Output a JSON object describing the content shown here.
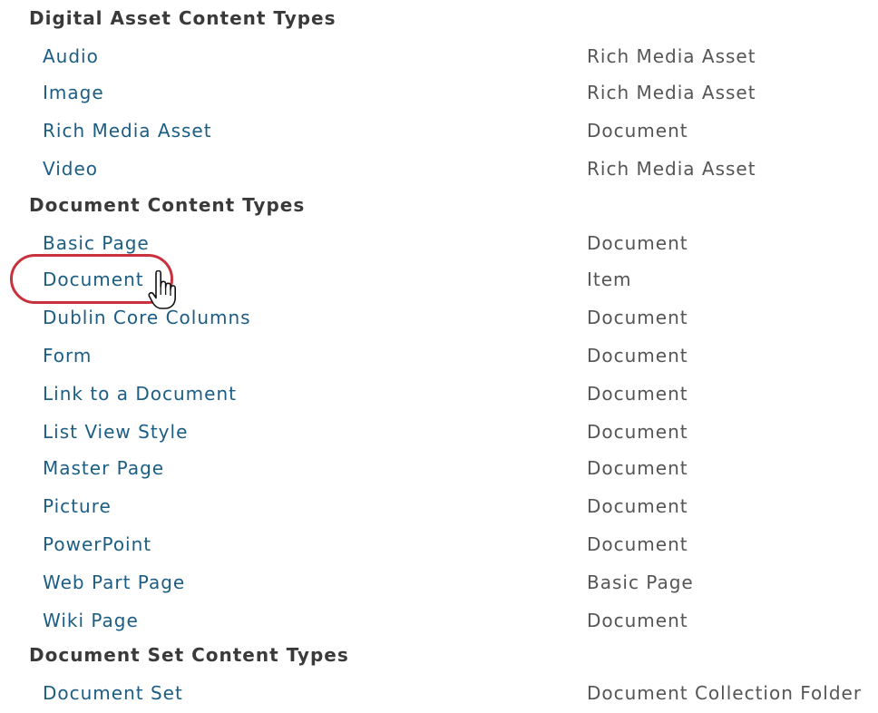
{
  "groups": [
    {
      "header": "Digital Asset Content Types",
      "items": [
        {
          "name": "Audio",
          "parent": "Rich Media Asset"
        },
        {
          "name": "Image",
          "parent": "Rich Media Asset"
        },
        {
          "name": "Rich Media Asset",
          "parent": "Document"
        },
        {
          "name": "Video",
          "parent": "Rich Media Asset"
        }
      ]
    },
    {
      "header": "Document Content Types",
      "items": [
        {
          "name": "Basic Page",
          "parent": "Document"
        },
        {
          "name": "Document",
          "parent": "Item"
        },
        {
          "name": "Dublin Core Columns",
          "parent": "Document"
        },
        {
          "name": "Form",
          "parent": "Document"
        },
        {
          "name": "Link to a Document",
          "parent": "Document"
        },
        {
          "name": "List View Style",
          "parent": "Document"
        },
        {
          "name": "Master Page",
          "parent": "Document"
        },
        {
          "name": "Picture",
          "parent": "Document"
        },
        {
          "name": "PowerPoint",
          "parent": "Document"
        },
        {
          "name": "Web Part Page",
          "parent": "Basic Page"
        },
        {
          "name": "Wiki Page",
          "parent": "Document"
        }
      ]
    },
    {
      "header": "Document Set Content Types",
      "items": [
        {
          "name": "Document Set",
          "parent": "Document Collection Folder"
        }
      ]
    }
  ],
  "colors": {
    "link": "#1c5d84",
    "header": "#3a3a3a",
    "parent_text": "#555555",
    "highlight": "#c8323c"
  },
  "icons": {
    "cursor": "pointing-hand-cursor-icon"
  }
}
